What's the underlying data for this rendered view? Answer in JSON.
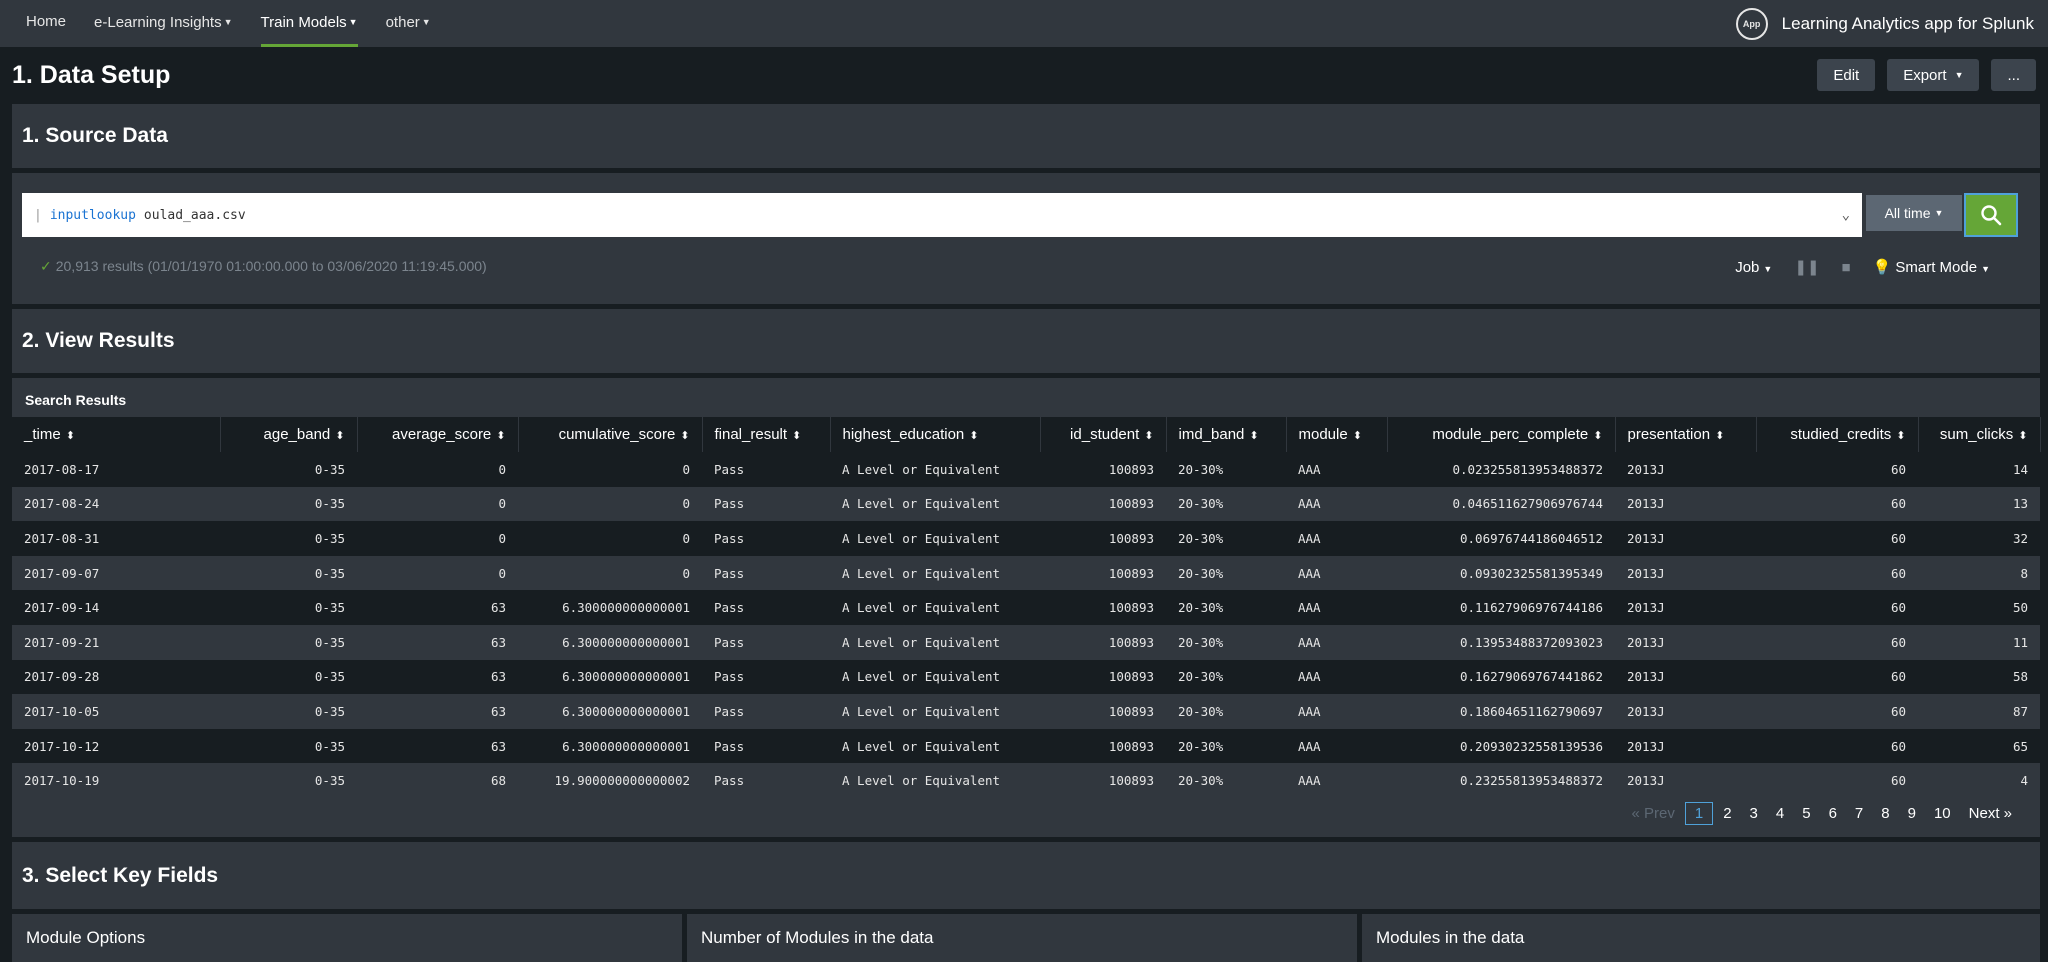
{
  "nav": {
    "items": [
      {
        "label": "Home",
        "caret": false,
        "active": false
      },
      {
        "label": "e-Learning Insights",
        "caret": true,
        "active": false
      },
      {
        "label": "Train Models",
        "caret": true,
        "active": true
      },
      {
        "label": "other",
        "caret": true,
        "active": false
      }
    ],
    "app_badge": "App",
    "app_name": "Learning Analytics app for Splunk"
  },
  "header": {
    "title": "1. Data Setup",
    "edit_label": "Edit",
    "export_label": "Export",
    "more_label": "..."
  },
  "source_panel": {
    "title": "1. Source Data",
    "query_pipe": "|",
    "query_command": "inputlookup",
    "query_args": "oulad_aaa.csv",
    "time_range": "All time",
    "status": "20,913 results (01/01/1970 01:00:00.000 to 03/06/2020 11:19:45.000)",
    "job_label": "Job",
    "mode_label": "Smart Mode"
  },
  "results_panel": {
    "title": "2. View Results",
    "label": "Search Results",
    "columns": [
      "_time",
      "age_band",
      "average_score",
      "cumulative_score",
      "final_result",
      "highest_education",
      "id_student",
      "imd_band",
      "module",
      "module_perc_complete",
      "presentation",
      "studied_credits",
      "sum_clicks"
    ],
    "rows": [
      [
        "2017-08-17",
        "0-35",
        "0",
        "0",
        "Pass",
        "A Level or Equivalent",
        "100893",
        "20-30%",
        "AAA",
        "0.023255813953488372",
        "2013J",
        "60",
        "14"
      ],
      [
        "2017-08-24",
        "0-35",
        "0",
        "0",
        "Pass",
        "A Level or Equivalent",
        "100893",
        "20-30%",
        "AAA",
        "0.046511627906976744",
        "2013J",
        "60",
        "13"
      ],
      [
        "2017-08-31",
        "0-35",
        "0",
        "0",
        "Pass",
        "A Level or Equivalent",
        "100893",
        "20-30%",
        "AAA",
        "0.06976744186046512",
        "2013J",
        "60",
        "32"
      ],
      [
        "2017-09-07",
        "0-35",
        "0",
        "0",
        "Pass",
        "A Level or Equivalent",
        "100893",
        "20-30%",
        "AAA",
        "0.09302325581395349",
        "2013J",
        "60",
        "8"
      ],
      [
        "2017-09-14",
        "0-35",
        "63",
        "6.300000000000001",
        "Pass",
        "A Level or Equivalent",
        "100893",
        "20-30%",
        "AAA",
        "0.11627906976744186",
        "2013J",
        "60",
        "50"
      ],
      [
        "2017-09-21",
        "0-35",
        "63",
        "6.300000000000001",
        "Pass",
        "A Level or Equivalent",
        "100893",
        "20-30%",
        "AAA",
        "0.13953488372093023",
        "2013J",
        "60",
        "11"
      ],
      [
        "2017-09-28",
        "0-35",
        "63",
        "6.300000000000001",
        "Pass",
        "A Level or Equivalent",
        "100893",
        "20-30%",
        "AAA",
        "0.16279069767441862",
        "2013J",
        "60",
        "58"
      ],
      [
        "2017-10-05",
        "0-35",
        "63",
        "6.300000000000001",
        "Pass",
        "A Level or Equivalent",
        "100893",
        "20-30%",
        "AAA",
        "0.18604651162790697",
        "2013J",
        "60",
        "87"
      ],
      [
        "2017-10-12",
        "0-35",
        "63",
        "6.300000000000001",
        "Pass",
        "A Level or Equivalent",
        "100893",
        "20-30%",
        "AAA",
        "0.20930232558139536",
        "2013J",
        "60",
        "65"
      ],
      [
        "2017-10-19",
        "0-35",
        "68",
        "19.900000000000002",
        "Pass",
        "A Level or Equivalent",
        "100893",
        "20-30%",
        "AAA",
        "0.23255813953488372",
        "2013J",
        "60",
        "4"
      ]
    ],
    "pagination": {
      "prev_label": "« Prev",
      "pages": [
        "1",
        "2",
        "3",
        "4",
        "5",
        "6",
        "7",
        "8",
        "9",
        "10"
      ],
      "current_page": "1",
      "next_label": "Next »"
    }
  },
  "key_fields_panel": {
    "title": "3. Select Key Fields",
    "sub_panels": [
      "Module Options",
      "Number of Modules in the data",
      "Modules in the data"
    ]
  },
  "colors": {
    "accent_green": "#65a637",
    "focus_blue": "#4fa1d9",
    "panel_bg": "#31373e",
    "page_bg": "#171d21"
  }
}
